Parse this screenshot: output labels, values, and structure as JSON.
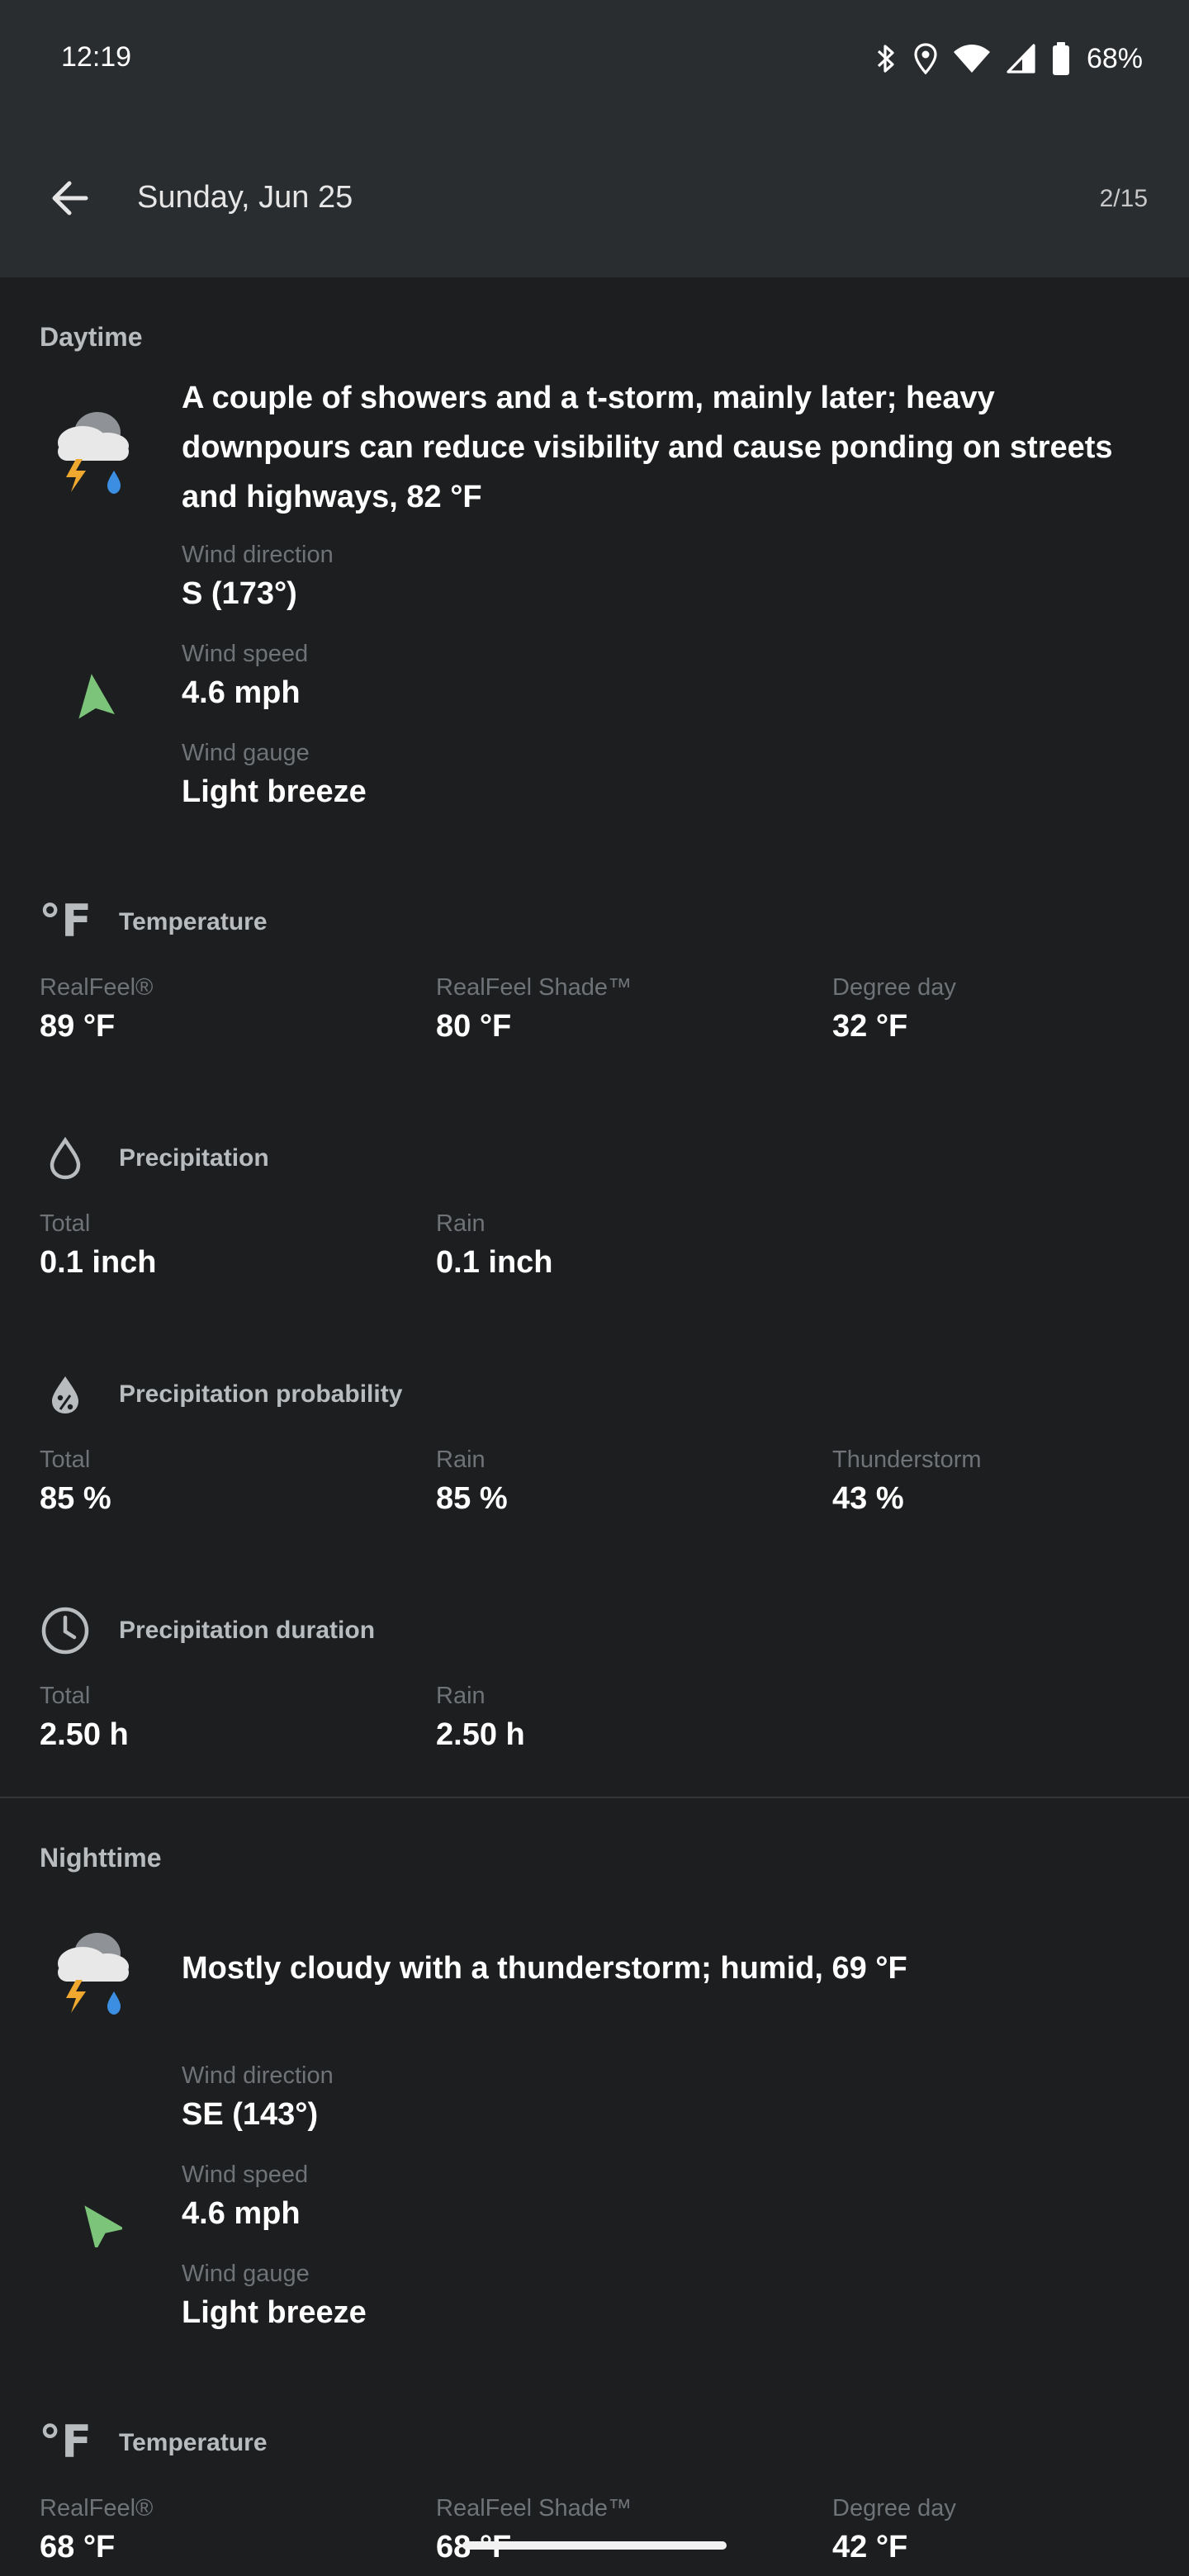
{
  "status_bar": {
    "time": "12:19",
    "battery": "68%"
  },
  "header": {
    "title": "Sunday, Jun 25",
    "page": "2/15"
  },
  "daytime": {
    "label": "Daytime",
    "description": "A couple of showers and a t-storm, mainly later; heavy downpours can reduce visibility and cause ponding on streets and highways, 82 °F",
    "wind": {
      "direction_label": "Wind direction",
      "direction": "S (173°)",
      "speed_label": "Wind speed",
      "speed": "4.6 mph",
      "gauge_label": "Wind gauge",
      "gauge": "Light breeze"
    },
    "temperature": {
      "title": "Temperature",
      "realfeel_label": "RealFeel®",
      "realfeel": "89 °F",
      "shade_label": "RealFeel Shade™",
      "shade": "80 °F",
      "degree_label": "Degree day",
      "degree": "32 °F"
    },
    "precipitation": {
      "title": "Precipitation",
      "total_label": "Total",
      "total": "0.1 inch",
      "rain_label": "Rain",
      "rain": "0.1 inch"
    },
    "probability": {
      "title": "Precipitation probability",
      "total_label": "Total",
      "total": "85 %",
      "rain_label": "Rain",
      "rain": "85 %",
      "thunder_label": "Thunderstorm",
      "thunder": "43 %"
    },
    "duration": {
      "title": "Precipitation duration",
      "total_label": "Total",
      "total": "2.50 h",
      "rain_label": "Rain",
      "rain": "2.50 h"
    }
  },
  "nighttime": {
    "label": "Nighttime",
    "description": "Mostly cloudy with a thunderstorm; humid, 69 °F",
    "wind": {
      "direction_label": "Wind direction",
      "direction": "SE (143°)",
      "speed_label": "Wind speed",
      "speed": "4.6 mph",
      "gauge_label": "Wind gauge",
      "gauge": "Light breeze"
    },
    "temperature": {
      "title": "Temperature",
      "realfeel_label": "RealFeel®",
      "realfeel": "68 °F",
      "shade_label": "RealFeel Shade™",
      "shade": "68 °F",
      "degree_label": "Degree day",
      "degree": "42 °F"
    }
  },
  "icons": {
    "back": "arrow-back-icon",
    "weather": "thunderstorm-rain-icon",
    "wind": "navigation-arrow-icon",
    "temperature": "fahrenheit-icon",
    "precipitation": "water-drop-icon",
    "probability": "drop-percent-icon",
    "duration": "clock-icon"
  },
  "colors": {
    "background": "#1c1e1f",
    "header": "#2a2d30",
    "wind_arrow": "#7cc47a",
    "label": "#6f7377",
    "section": "#b9bcbf"
  }
}
